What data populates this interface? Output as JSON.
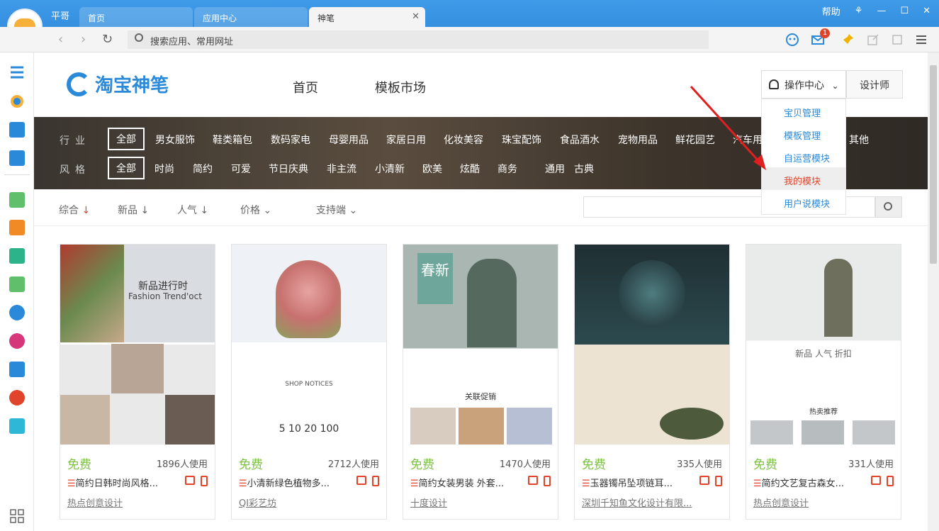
{
  "browser": {
    "user_name": "平哥",
    "tabs": [
      {
        "label": "首页"
      },
      {
        "label": "应用中心"
      },
      {
        "label": "神笔"
      }
    ],
    "help": "帮助",
    "url_placeholder": "搜索应用、常用网址",
    "mail_badge": "1"
  },
  "site": {
    "logo_text": "淘宝神笔",
    "nav": [
      "首页",
      "模板市场"
    ],
    "op_center": "操作中心",
    "designer": "设计师",
    "dropdown": [
      "宝贝管理",
      "模板管理",
      "自运营模块",
      "我的模块",
      "用户说模块"
    ]
  },
  "filters": {
    "industry_label": "行业",
    "industry": [
      "全部",
      "男女服饰",
      "鞋类箱包",
      "数码家电",
      "母婴用品",
      "家居日用",
      "化妆美容",
      "珠宝配饰",
      "食品酒水",
      "宠物用品",
      "鲜花园艺",
      "汽车用品",
      "其他"
    ],
    "style_label": "风格",
    "style": [
      "全部",
      "时尚",
      "简约",
      "可爱",
      "节日庆典",
      "非主流",
      "小清新",
      "欧美",
      "炫酷",
      "商务",
      "通用",
      "古典"
    ]
  },
  "sort": {
    "items": [
      "综合",
      "新品",
      "人气",
      "价格",
      "支持端"
    ]
  },
  "cards": [
    {
      "price": "免费",
      "uses": "1896人使用",
      "title": "简约日韩时尚风格...",
      "author": "热点创意设计",
      "thumb_text": "新品进行时",
      "thumb_sub": "Fashion Trend'oct"
    },
    {
      "price": "免费",
      "uses": "2712人使用",
      "title": "小清新绿色植物多...",
      "author": "QI彩艺坊",
      "thumb_text": "SHOP NOTICES",
      "thumb_sub": "5   10   20   100"
    },
    {
      "price": "免费",
      "uses": "1470人使用",
      "title": "简约女装男装 外套...",
      "author": "十度设计",
      "thumb_text": "春新",
      "thumb_sub": "关联促销"
    },
    {
      "price": "免费",
      "uses": "335人使用",
      "title": "玉器镯吊坠项链耳...",
      "author": "深圳千知鱼文化设计有限...",
      "thumb_text": "",
      "thumb_sub": ""
    },
    {
      "price": "免费",
      "uses": "331人使用",
      "title": "简约文艺复古森女...",
      "author": "热点创意设计",
      "thumb_text": "新品  人气  折扣",
      "thumb_sub": "热卖推荐"
    }
  ]
}
